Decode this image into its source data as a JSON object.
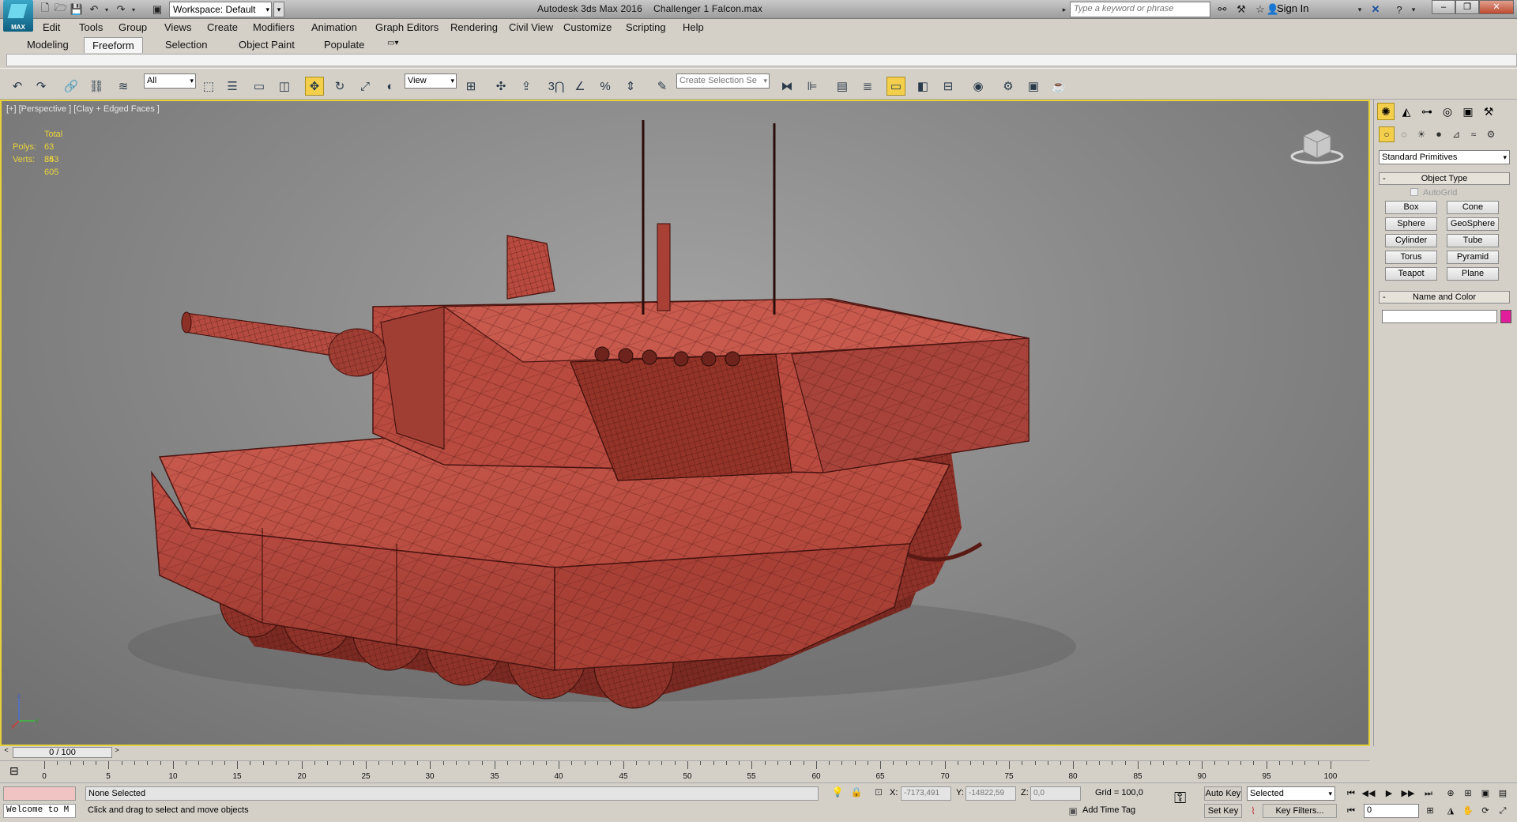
{
  "title": {
    "app": "Autodesk 3ds Max 2016",
    "file": "Challenger 1 Falcon.max",
    "workspace": "Workspace: Default",
    "search_placeholder": "Type a keyword or phrase",
    "sign_in": "Sign In",
    "logo": "MAX"
  },
  "menu": [
    "Edit",
    "Tools",
    "Group",
    "Views",
    "Create",
    "Modifiers",
    "Animation",
    "Graph Editors",
    "Rendering",
    "Civil View",
    "Customize",
    "Scripting",
    "Help"
  ],
  "ribbon_tabs": [
    "Modeling",
    "Freeform",
    "Selection",
    "Object Paint",
    "Populate"
  ],
  "ribbon_active": "Freeform",
  "toolbar": {
    "filter": "All",
    "coord_system": "View",
    "selection_set_placeholder": "Create Selection Se",
    "snap_label": "3"
  },
  "viewport": {
    "label": "[+] [Perspective ] [Clay + Edged Faces ]",
    "stats_header": "Total",
    "polys_label": "Polys:",
    "polys": "63 353",
    "verts_label": "Verts:",
    "verts": "84 605",
    "colors": {
      "active_border": "#e5d23a",
      "stats": "#e9d23a",
      "model": "#b5473d"
    }
  },
  "command_panel": {
    "category": "Standard Primitives",
    "object_type_title": "Object Type",
    "autogrid": "AutoGrid",
    "primitives": [
      "Box",
      "Cone",
      "Sphere",
      "GeoSphere",
      "Cylinder",
      "Tube",
      "Torus",
      "Pyramid",
      "Teapot",
      "Plane"
    ],
    "name_color_title": "Name and Color",
    "name_value": "",
    "swatch_color": "#e21d9a"
  },
  "time_slider": {
    "frame": "0 / 100",
    "ticks": [
      "0",
      "5",
      "10",
      "15",
      "20",
      "25",
      "30",
      "35",
      "40",
      "45",
      "50",
      "55",
      "60",
      "65",
      "70",
      "75",
      "80",
      "85",
      "90",
      "95",
      "100"
    ]
  },
  "status": {
    "welcome": "Welcome to M",
    "selection": "None Selected",
    "prompt": "Click and drag to select and move objects",
    "x_label": "X:",
    "x": "-7173,491",
    "y_label": "Y:",
    "y": "-14822,59",
    "z_label": "Z:",
    "z": "0,0",
    "grid": "Grid = 100,0",
    "add_time_tag": "Add Time Tag",
    "auto_key": "Auto Key",
    "set_key": "Set Key",
    "key_mode": "Selected",
    "key_filters": "Key Filters...",
    "current_frame": "0"
  }
}
